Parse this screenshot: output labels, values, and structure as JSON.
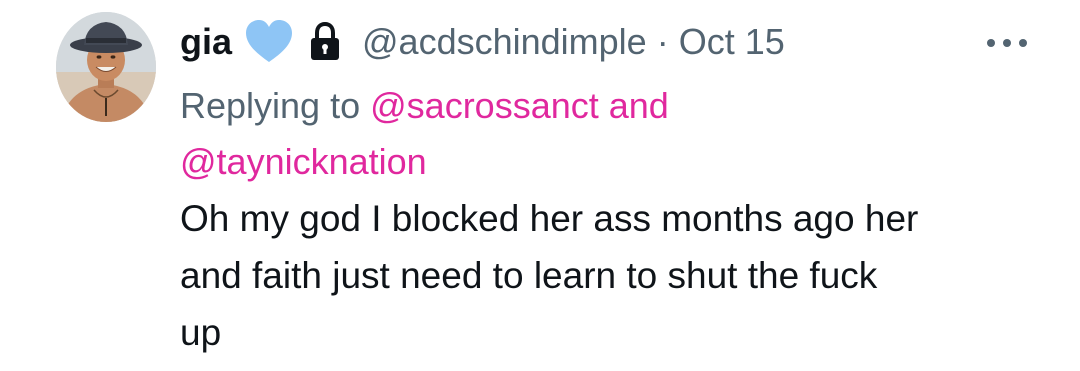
{
  "tweet": {
    "display_name": "gia",
    "handle": "@acdschindimple",
    "separator": "·",
    "date": "Oct 15",
    "heart_color": "#8ec5f5",
    "reply": {
      "prefix": "Replying to",
      "mention_1": "@sacrossanct",
      "conjunction": "and",
      "mention_2": "@taynicknation",
      "mention_color": "#e0289e"
    },
    "text_line_1": "Oh my god I blocked her ass months ago her",
    "text_line_2": "and faith just need to learn to shut the fuck",
    "text_line_3": "up"
  },
  "icons": {
    "avatar": "avatar",
    "heart": "blue-heart-icon",
    "lock": "lock-icon",
    "more": "more-options-icon"
  }
}
